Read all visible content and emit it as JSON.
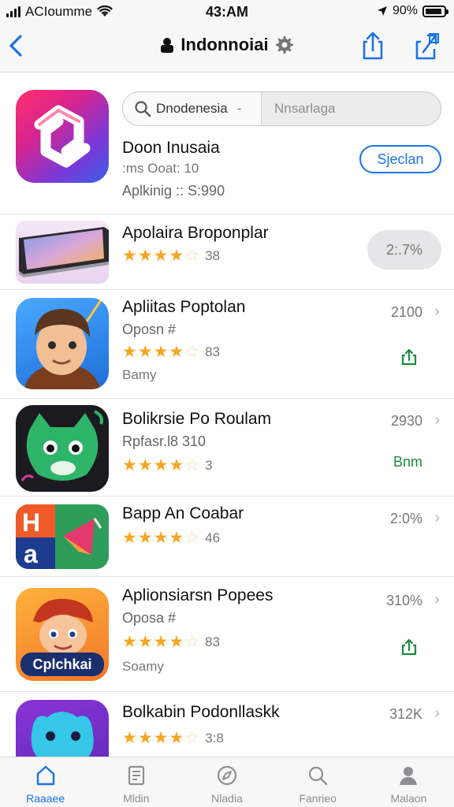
{
  "status_bar": {
    "carrier": "ACIoumme",
    "time": "43:AM",
    "battery": "90%",
    "battery_level": 0.9
  },
  "nav": {
    "title": "Indonnoiai",
    "back_icon": "chevron-left-icon",
    "settings_icon": "gear-icon",
    "share_icon": "share-icon",
    "share_alt_icon": "share-alt-icon"
  },
  "featured": {
    "search_left": "Dnodenesia",
    "search_dash": "-",
    "search_right": "Nnsarlaga",
    "title": "Doon Inusaia",
    "line1": ":ms Ooat: 10",
    "line2": "Aplkinig :: S:990",
    "button": "Sjeclan",
    "icon_name": "app-logo-icon"
  },
  "apps": [
    {
      "title": "Apolaira Broponplar",
      "rating": 3.5,
      "rating_count": "38",
      "pill": "2:.7%",
      "icon_name": "phone-image-icon"
    },
    {
      "title": "Apliitas Poptolan",
      "subtitle": "Oposn #",
      "rating": 3.5,
      "rating_count": "83",
      "extra": "Bamy",
      "size": "2100",
      "action_icon": "share-icon",
      "icon_name": "character-icon"
    },
    {
      "title": "Bolikrsie Po Roulam",
      "subtitle": "Rpfasr.l8 310",
      "rating": 3.5,
      "rating_count": "3",
      "size": "2930",
      "action_text": "Bnm",
      "icon_name": "monster-icon"
    },
    {
      "title": "Bapp An Coabar",
      "rating": 3.5,
      "rating_count": "46",
      "size": "2:0%",
      "icon_name": "letters-icon"
    },
    {
      "title": "Aplionsiarsn Popees",
      "subtitle": "Oposa #",
      "rating": 3.5,
      "rating_count": "83",
      "extra": "Soamy",
      "size": "310%",
      "action_icon": "share-icon",
      "icon_name": "cartoon-icon",
      "icon_text": "Cplchkai"
    },
    {
      "title": "Bolkabin Podonllaskk",
      "rating": 3.5,
      "rating_count": "3:8",
      "size": "312K",
      "icon_name": "creature-icon"
    }
  ],
  "tabs": [
    {
      "label": "Raaaee",
      "icon": "home-icon",
      "active": true
    },
    {
      "label": "Mldin",
      "icon": "document-icon",
      "active": false
    },
    {
      "label": "Nladia",
      "icon": "compass-icon",
      "active": false
    },
    {
      "label": "Fanrieo",
      "icon": "search-icon",
      "active": false
    },
    {
      "label": "Malaon",
      "icon": "person-icon",
      "active": false
    }
  ],
  "colors": {
    "accent": "#1a73e8",
    "star": "#f5a623",
    "action_green": "#1c8a3c"
  }
}
